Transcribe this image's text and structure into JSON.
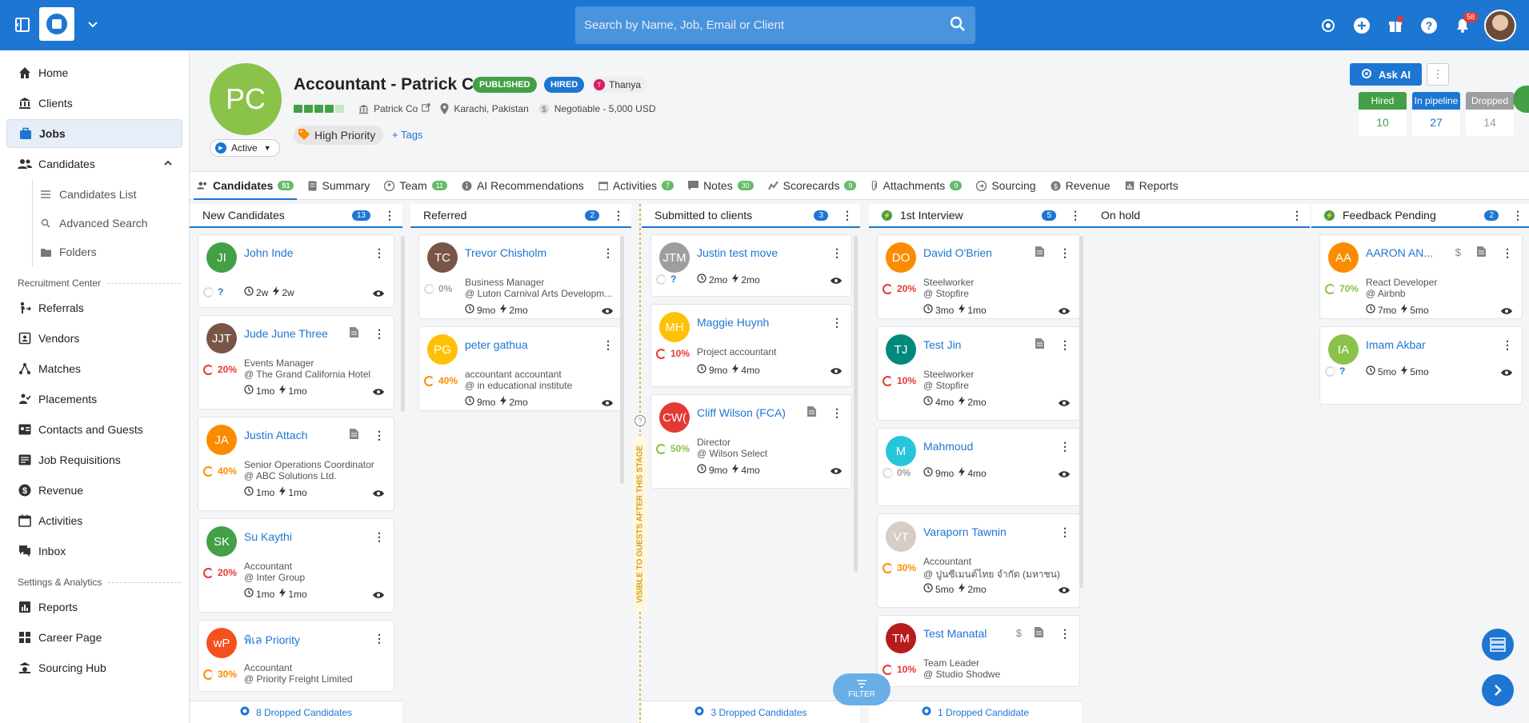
{
  "topbar": {
    "search_placeholder": "Search by Name, Job, Email or Client",
    "notification_count": "58"
  },
  "sidebar": {
    "items": [
      {
        "label": "Home",
        "icon": "home-icon"
      },
      {
        "label": "Clients",
        "icon": "bank-icon"
      },
      {
        "label": "Jobs",
        "icon": "briefcase-icon"
      },
      {
        "label": "Candidates",
        "icon": "users-icon"
      }
    ],
    "candidates_sub": [
      "Candidates List",
      "Advanced Search",
      "Folders"
    ],
    "section_recruitment": "Recruitment Center",
    "recruitment_items": [
      "Referrals",
      "Vendors",
      "Matches",
      "Placements",
      "Contacts and Guests",
      "Job Requisitions",
      "Revenue",
      "Activities",
      "Inbox"
    ],
    "section_settings": "Settings & Analytics",
    "settings_items": [
      "Reports",
      "Career Page",
      "Sourcing Hub"
    ]
  },
  "job": {
    "avatar": "PC",
    "title": "Accountant - Patrick Co",
    "tag_published": "PUBLISHED",
    "tag_hired": "HIRED",
    "owner_initial": "T",
    "owner": "Thanya",
    "status": "Active",
    "client": "Patrick Co",
    "location": "Karachi, Pakistan",
    "salary": "Negotiable - 5,000 USD",
    "priority": "High Priority",
    "tags_link": "+ Tags",
    "ask_ai": "Ask AI",
    "progress_filled": 4,
    "progress_total": 5,
    "stats": [
      {
        "label": "Hired",
        "value": "10",
        "color": "#43a047"
      },
      {
        "label": "In pipeline",
        "value": "27",
        "color": "#1d76d2"
      },
      {
        "label": "Dropped",
        "value": "14",
        "color": "#9e9e9e"
      }
    ]
  },
  "tabs": [
    {
      "label": "Candidates",
      "count": "51"
    },
    {
      "label": "Summary",
      "count": ""
    },
    {
      "label": "Team",
      "count": "11"
    },
    {
      "label": "AI Recommendations",
      "count": ""
    },
    {
      "label": "Activities",
      "count": "7"
    },
    {
      "label": "Notes",
      "count": "30"
    },
    {
      "label": "Scorecards",
      "count": "9"
    },
    {
      "label": "Attachments",
      "count": "9"
    },
    {
      "label": "Sourcing",
      "count": ""
    },
    {
      "label": "Revenue",
      "count": ""
    },
    {
      "label": "Reports",
      "count": ""
    }
  ],
  "columns": [
    {
      "title": "New Candidates",
      "count": "13",
      "dropped": "8 Dropped Candidates"
    },
    {
      "title": "Referred",
      "count": "2",
      "dropped": ""
    },
    {
      "title": "Submitted to clients",
      "count": "3",
      "dropped": "3 Dropped Candidates"
    },
    {
      "title": "1st Interview",
      "count": "5",
      "dropped": "1 Dropped Candidate"
    },
    {
      "title": "On hold",
      "count": "",
      "dropped": ""
    },
    {
      "title": "Feedback Pending",
      "count": "2",
      "dropped": ""
    },
    {
      "title": "2",
      "count": "",
      "dropped": ""
    }
  ],
  "visible_to_guests": "VISIBLE TO GUESTS AFTER THIS STAGE",
  "filter_label": "FILTER",
  "cards": {
    "c0": [
      {
        "initials": "JI",
        "name": "John Inde",
        "title": "",
        "company": "",
        "pct": "?",
        "t1": "2w",
        "t2": "2w",
        "color": "#43a047"
      },
      {
        "initials": "JJT",
        "name": "Jude June Three",
        "title": "Events Manager",
        "company": "@ The Grand California Hotel",
        "pct": "20%",
        "t1": "1mo",
        "t2": "1mo",
        "color": "#795548"
      },
      {
        "initials": "JA",
        "name": "Justin Attach",
        "title": "Senior Operations Coordinator",
        "company": "@ ABC Solutions Ltd.",
        "pct": "40%",
        "t1": "1mo",
        "t2": "1mo",
        "color": "#fb8c00"
      },
      {
        "initials": "SK",
        "name": "Su Kaythi",
        "title": "Accountant",
        "company": "@ Inter Group",
        "pct": "20%",
        "t1": "1mo",
        "t2": "1mo",
        "color": "#43a047"
      },
      {
        "initials": "wP",
        "name": "พิเล Priority",
        "title": "Accountant",
        "company": "@ Priority Freight Limited",
        "pct": "30%",
        "t1": "",
        "t2": "",
        "color": "#f4511e"
      }
    ],
    "c1": [
      {
        "initials": "TC",
        "name": "Trevor Chisholm",
        "title": "Business Manager",
        "company": "@ Luton Carnival Arts Developm...",
        "pct": "0%",
        "t1": "9mo",
        "t2": "2mo",
        "color": "#795548"
      },
      {
        "initials": "PG",
        "name": "peter gathua",
        "title": "accountant accountant",
        "company": "@ in educational institute",
        "pct": "40%",
        "t1": "9mo",
        "t2": "2mo",
        "color": "#ffc107"
      }
    ],
    "c2": [
      {
        "initials": "JTM",
        "name": "Justin test move",
        "title": "",
        "company": "",
        "pct": "?",
        "t1": "2mo",
        "t2": "2mo",
        "color": "#9e9e9e"
      },
      {
        "initials": "MH",
        "name": "Maggie Huynh",
        "title": "Project accountant",
        "company": "",
        "pct": "10%",
        "t1": "9mo",
        "t2": "4mo",
        "color": "#ffc107"
      },
      {
        "initials": "CW(",
        "name": "Cliff Wilson (FCA)",
        "title": "Director",
        "company": "@ Wilson Select",
        "pct": "50%",
        "t1": "9mo",
        "t2": "4mo",
        "color": "#e53935"
      }
    ],
    "c3": [
      {
        "initials": "DO",
        "name": "David O'Brien",
        "title": "Steelworker",
        "company": "@ Stopfire",
        "pct": "20%",
        "t1": "3mo",
        "t2": "1mo",
        "color": "#fb8c00"
      },
      {
        "initials": "TJ",
        "name": "Test Jin",
        "title": "Steelworker",
        "company": "@ Stopfire",
        "pct": "10%",
        "t1": "4mo",
        "t2": "2mo",
        "color": "#00897b"
      },
      {
        "initials": "M",
        "name": "Mahmoud",
        "title": "",
        "company": "",
        "pct": "0%",
        "t1": "9mo",
        "t2": "4mo",
        "color": "#26c6da"
      },
      {
        "initials": "VT",
        "name": "Varaporn Tawnin",
        "title": "Accountant",
        "company": "@ ปูนซีเมนต์ไทย จำกัด (มหาชน)",
        "pct": "30%",
        "t1": "5mo",
        "t2": "2mo",
        "color": "#d7ccc8"
      },
      {
        "initials": "TM",
        "name": "Test Manatal",
        "title": "Team Leader",
        "company": "@ Studio Shodwe",
        "pct": "10%",
        "t1": "",
        "t2": "",
        "color": "#b71c1c"
      }
    ],
    "c5": [
      {
        "initials": "AA",
        "name": "AARON AN...",
        "title": "React Developer",
        "company": "@ Airbnb",
        "pct": "70%",
        "t1": "7mo",
        "t2": "5mo",
        "color": "#fb8c00"
      },
      {
        "initials": "IA",
        "name": "Imam Akbar",
        "title": "",
        "company": "",
        "pct": "?",
        "t1": "5mo",
        "t2": "5mo",
        "color": "#8bc34a"
      }
    ]
  }
}
